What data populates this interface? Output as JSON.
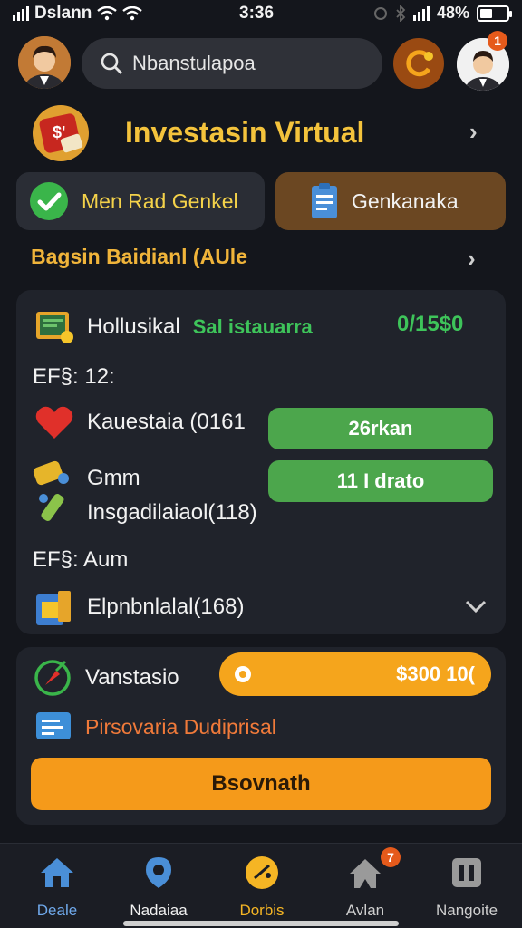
{
  "status_bar": {
    "carrier": "Dslann",
    "time": "3:36",
    "battery": "48%",
    "battery_level": 0.48
  },
  "header": {
    "search_placeholder": "Nbanstulapoa",
    "notification_count": "1"
  },
  "title": {
    "text": "Investasin Virtual"
  },
  "actions": {
    "primary_label": "Men Rad Genkel",
    "secondary_label": "Genkanaka"
  },
  "section": {
    "label": "Bagsin Baidianl (AUle"
  },
  "portfolio": {
    "row1_label": "Hollusikal",
    "row1_status": "Sal istauarra",
    "row1_value": "0/15$0",
    "row2_label": "EF§: 12:",
    "row3_label": "Kauestaia (0161",
    "row3_button": "26rkan",
    "row4_label_top": "Gmm",
    "row4_label": "Insgadilaiaol(118)",
    "row4_button": "11 I drato",
    "row5_label": "EF§: Aum",
    "row6_label": "Elpnbnlalal(168)"
  },
  "investment": {
    "label": "Vanstasio",
    "amount": "$300 10(",
    "subtitle": "Pirsovaria Dudiprisal",
    "button": "Bsovnath"
  },
  "bottom_nav": {
    "items": [
      {
        "label": "Deale",
        "color": "#6fa8ea"
      },
      {
        "label": "Nadaiaa",
        "color": "#f2f2f2"
      },
      {
        "label": "Dorbis",
        "color": "#f5b524"
      },
      {
        "label": "Avlan",
        "color": "#cfcfcf"
      },
      {
        "label": "Nangoite",
        "color": "#cfcfcf"
      }
    ],
    "badge": "7"
  },
  "colors": {
    "accent_orange": "#f5a51c",
    "accent_yellow": "#f4c33c",
    "accent_green": "#4ca64c",
    "background": "#14161c"
  }
}
